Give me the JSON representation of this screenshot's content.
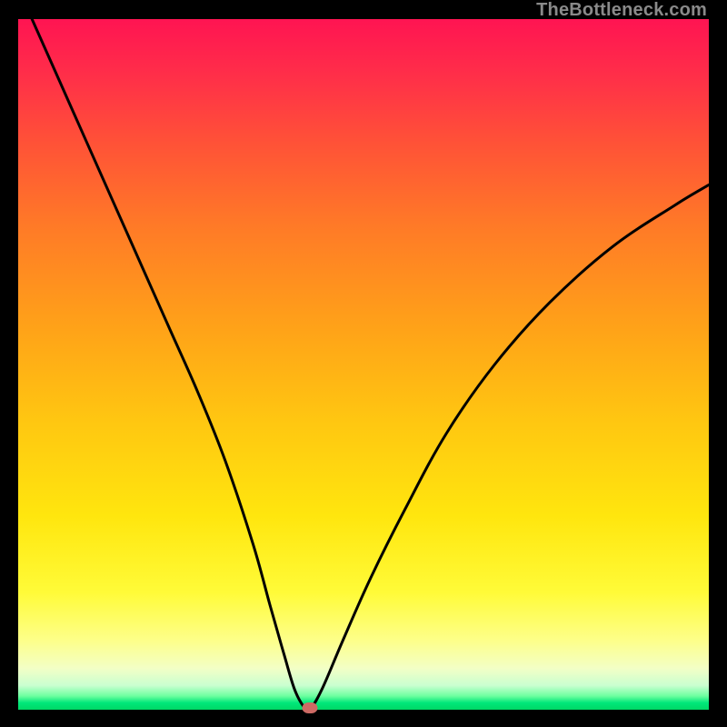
{
  "watermark": "TheBottleneck.com",
  "chart_data": {
    "type": "line",
    "title": "",
    "xlabel": "",
    "ylabel": "",
    "xlim": [
      0,
      100
    ],
    "ylim": [
      0,
      100
    ],
    "grid": false,
    "legend": false,
    "series": [
      {
        "name": "bottleneck-curve",
        "x": [
          2,
          6,
          10,
          14,
          18,
          22,
          26,
          30,
          34,
          36.5,
          38.5,
          40,
          41.3,
          42.2,
          44,
          47,
          51,
          56,
          62,
          69,
          77,
          86,
          95,
          100
        ],
        "y": [
          100,
          91,
          82,
          73,
          64,
          55,
          46,
          36,
          24,
          15,
          8,
          3,
          0.5,
          0,
          3,
          10,
          19,
          29,
          40,
          50,
          59,
          67,
          73,
          76
        ]
      }
    ],
    "marker": {
      "x": 42.2,
      "y": 0.3
    },
    "gradient_stops": [
      {
        "pct": 0,
        "color": "#ff1452"
      },
      {
        "pct": 18,
        "color": "#ff5237"
      },
      {
        "pct": 45,
        "color": "#ffa318"
      },
      {
        "pct": 72,
        "color": "#ffe60e"
      },
      {
        "pct": 90,
        "color": "#fdff8a"
      },
      {
        "pct": 97,
        "color": "#8fffb0"
      },
      {
        "pct": 100,
        "color": "#00d865"
      }
    ]
  }
}
